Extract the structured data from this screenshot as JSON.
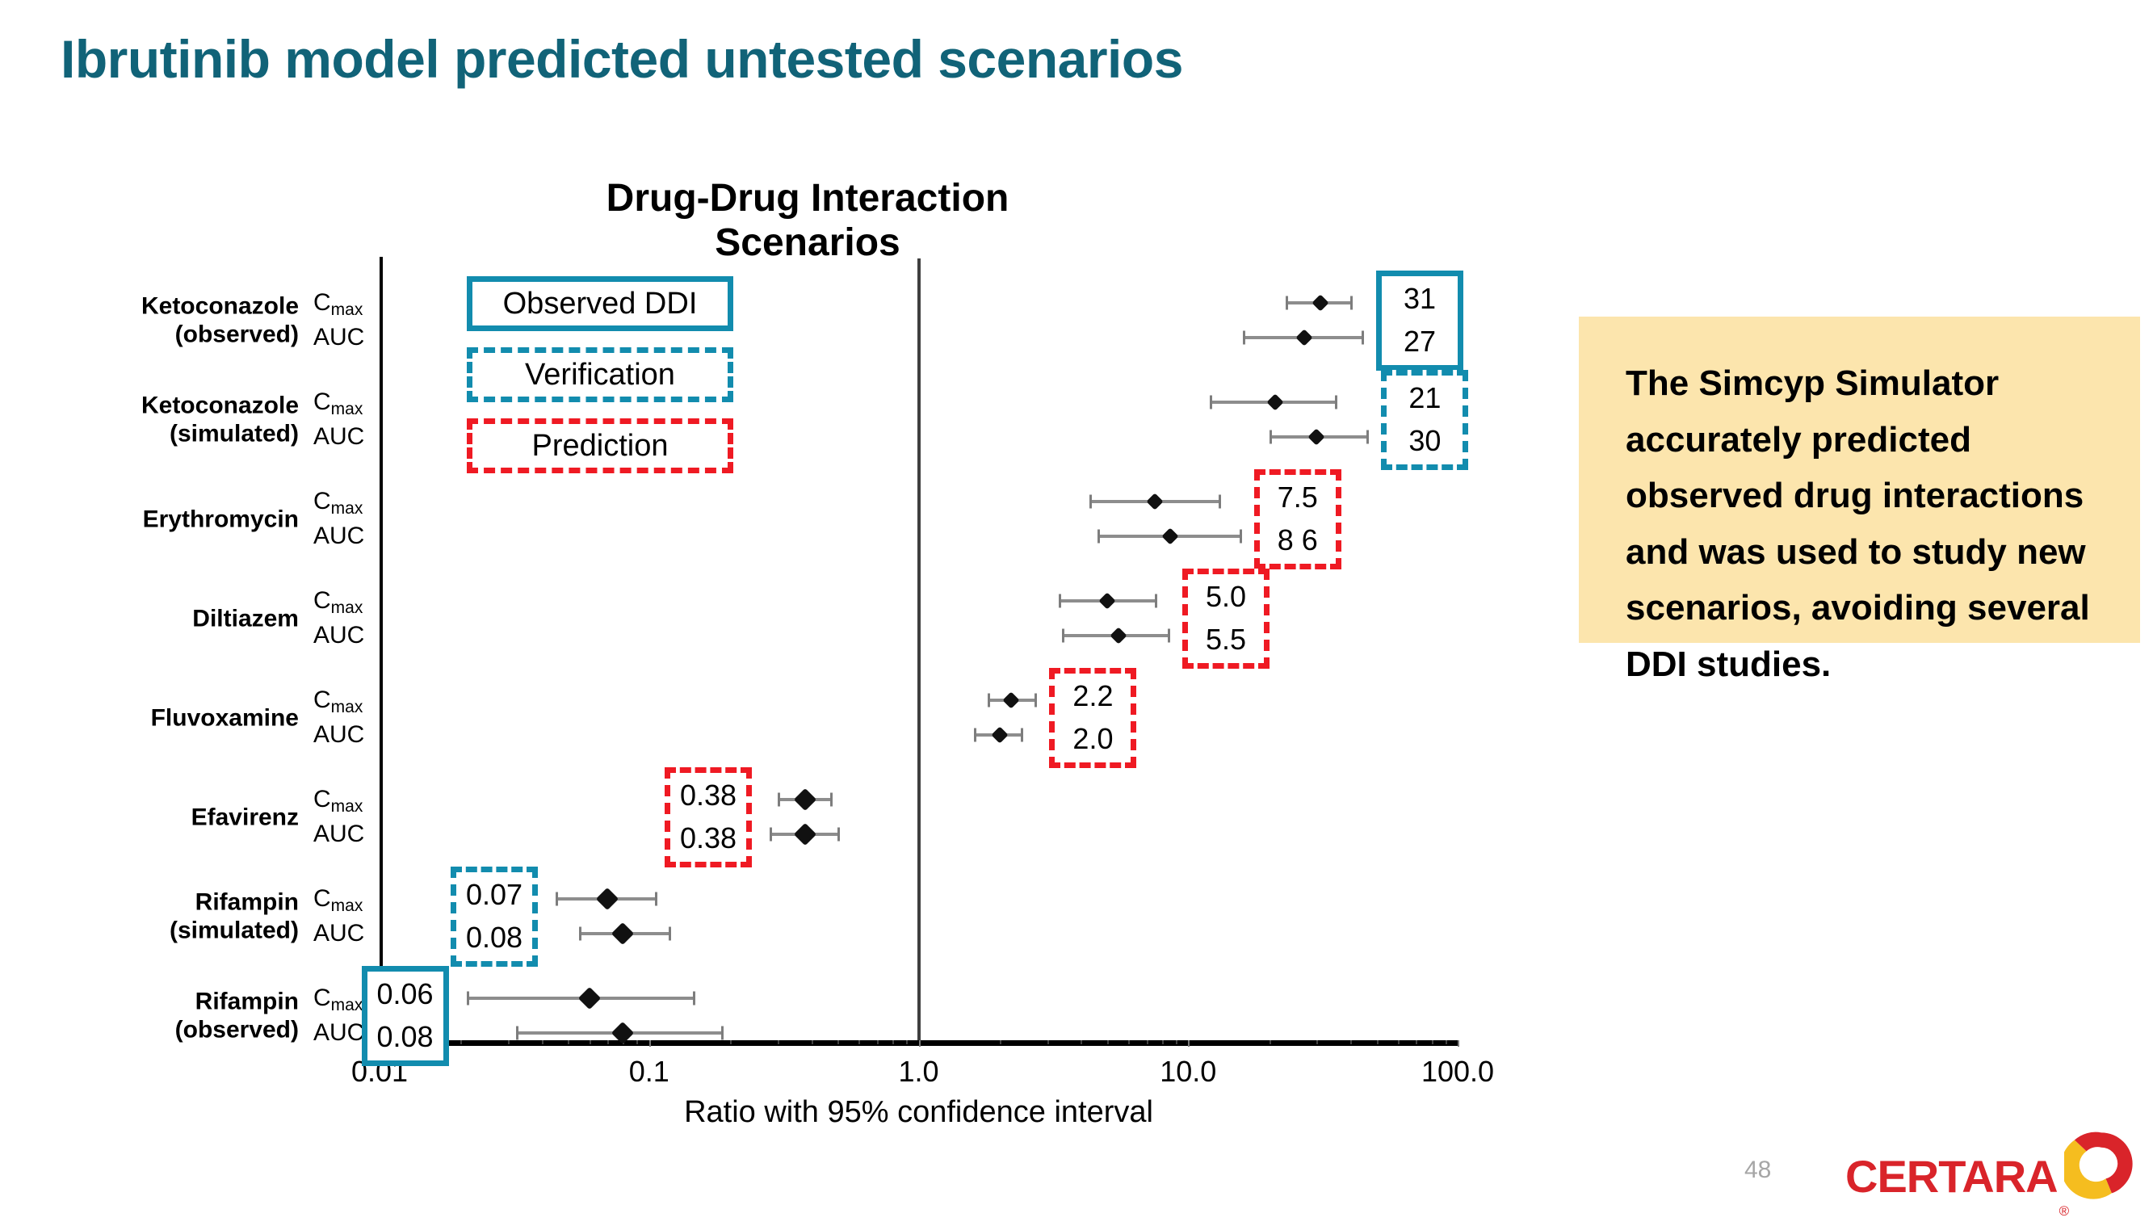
{
  "slide": {
    "title": "Ibrutinib model predicted untested scenarios",
    "page_number": "48",
    "title_color": "#116378"
  },
  "callout": {
    "text": "The Simcyp Simulator accurately predicted observed drug interactions and was used to study new scenarios, avoiding several DDI studies.",
    "background": "#fce5ad"
  },
  "logo": {
    "word": "CERTARA",
    "registered": "®",
    "red": "#d9242a",
    "yellow": "#f5bd1f"
  },
  "legend": {
    "items": [
      {
        "label": "Observed DDI",
        "style": "solid-teal",
        "color": "#128cae"
      },
      {
        "label": "Verification",
        "style": "dashed-teal",
        "color": "#128cae"
      },
      {
        "label": "Prediction",
        "style": "dashed-red",
        "color": "#ef1a23"
      }
    ]
  },
  "chart_data": {
    "type": "scatter",
    "title": "Drug-Drug Interaction Scenarios",
    "xlabel": "Ratio with 95% confidence interval",
    "ylabel": "",
    "xscale": "log",
    "xlim": [
      0.01,
      100.0
    ],
    "xticks": [
      0.01,
      0.1,
      1.0,
      10.0,
      100.0
    ],
    "xticklabels": [
      "0.01",
      "0.1",
      "1.0",
      "10.0",
      "100.0"
    ],
    "grid": false,
    "reference_line": 1.0,
    "legend_position": "inside-left",
    "rows": [
      {
        "group": "Ketoconazole (observed)",
        "group_line1": "Ketoconazole",
        "group_line2": "(observed)",
        "box_style": "solid-teal",
        "box_side": "right",
        "values_label": [
          "31",
          "27"
        ],
        "points": [
          {
            "metric": "Cmax",
            "value": 31,
            "low": 23,
            "high": 40
          },
          {
            "metric": "AUC",
            "value": 27,
            "low": 16,
            "high": 44
          }
        ]
      },
      {
        "group": "Ketoconazole (simulated)",
        "group_line1": "Ketoconazole",
        "group_line2": "(simulated)",
        "box_style": "dashed-teal",
        "box_side": "right",
        "values_label": [
          "21",
          "30"
        ],
        "points": [
          {
            "metric": "Cmax",
            "value": 21,
            "low": 12,
            "high": 35
          },
          {
            "metric": "AUC",
            "value": 30,
            "low": 20,
            "high": 46
          }
        ]
      },
      {
        "group": "Erythromycin",
        "group_line1": "Erythromycin",
        "group_line2": "",
        "box_style": "dashed-red",
        "box_side": "right",
        "values_label": [
          "7.5",
          "8 6"
        ],
        "points": [
          {
            "metric": "Cmax",
            "value": 7.5,
            "low": 4.3,
            "high": 13.0
          },
          {
            "metric": "AUC",
            "value": 8.6,
            "low": 4.6,
            "high": 15.5
          }
        ]
      },
      {
        "group": "Diltiazem",
        "group_line1": "Diltiazem",
        "group_line2": "",
        "box_style": "dashed-red",
        "box_side": "right",
        "values_label": [
          "5.0",
          "5.5"
        ],
        "points": [
          {
            "metric": "Cmax",
            "value": 5.0,
            "low": 3.3,
            "high": 7.5
          },
          {
            "metric": "AUC",
            "value": 5.5,
            "low": 3.4,
            "high": 8.4
          }
        ]
      },
      {
        "group": "Fluvoxamine",
        "group_line1": "Fluvoxamine",
        "group_line2": "",
        "box_style": "dashed-red",
        "box_side": "right",
        "values_label": [
          "2.2",
          "2.0"
        ],
        "points": [
          {
            "metric": "Cmax",
            "value": 2.2,
            "low": 1.8,
            "high": 2.7
          },
          {
            "metric": "AUC",
            "value": 2.0,
            "low": 1.6,
            "high": 2.4
          }
        ]
      },
      {
        "group": "Efavirenz",
        "group_line1": "Efavirenz",
        "group_line2": "",
        "box_style": "dashed-red",
        "box_side": "left",
        "values_label": [
          "0.38",
          "0.38"
        ],
        "points": [
          {
            "metric": "Cmax",
            "value": 0.38,
            "low": 0.3,
            "high": 0.47
          },
          {
            "metric": "AUC",
            "value": 0.38,
            "low": 0.28,
            "high": 0.5
          }
        ]
      },
      {
        "group": "Rifampin (simulated)",
        "group_line1": "Rifampin",
        "group_line2": "(simulated)",
        "box_style": "dashed-teal",
        "box_side": "left",
        "values_label": [
          "0.07",
          "0.08"
        ],
        "points": [
          {
            "metric": "Cmax",
            "value": 0.07,
            "low": 0.045,
            "high": 0.105
          },
          {
            "metric": "AUC",
            "value": 0.08,
            "low": 0.055,
            "high": 0.118
          }
        ]
      },
      {
        "group": "Rifampin (observed)",
        "group_line1": "Rifampin",
        "group_line2": "(observed)",
        "box_style": "solid-teal",
        "box_side": "left",
        "values_label": [
          "0.06",
          "0.08"
        ],
        "points": [
          {
            "metric": "Cmax",
            "value": 0.06,
            "low": 0.021,
            "high": 0.145
          },
          {
            "metric": "AUC",
            "value": 0.08,
            "low": 0.032,
            "high": 0.185
          }
        ]
      }
    ]
  }
}
